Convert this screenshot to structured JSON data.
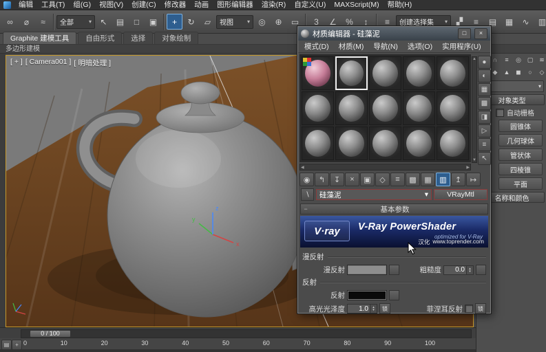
{
  "colors": {
    "accent_blue": "#2e5e8f",
    "viewport_border": "#c79a2c",
    "banner_blue": "#1a2a66",
    "wood_brown": "#6b4526",
    "selection_white": "#f0f0f0"
  },
  "ui": {
    "dropdown_arrow": "▾",
    "spin_up": "▴",
    "spin_down": "▾",
    "scroll_up": "▲",
    "scroll_down": "▼",
    "scroll_left": "◀",
    "scroll_right": "▶",
    "rollout_minus": "−",
    "eyedrop_glyph": "∖",
    "mini_track": "▤",
    "mini_plus": "+"
  },
  "menubar": {
    "items": [
      "编辑",
      "工具(T)",
      "组(G)",
      "视图(V)",
      "创建(C)",
      "修改器",
      "动画",
      "图形编辑器",
      "渲染(R)",
      "自定义(U)",
      "MAXScript(M)",
      "帮助(H)"
    ]
  },
  "toolbar": {
    "selection_filter": "全部",
    "ref_coord": "视图",
    "named_sets": "创建选择集",
    "icons_left": [
      {
        "glyph": "∞"
      },
      {
        "glyph": "⌀"
      },
      {
        "glyph": "≈"
      }
    ],
    "icons_select": [
      {
        "glyph": "↖"
      },
      {
        "glyph": "▤"
      },
      {
        "glyph": "□"
      },
      {
        "glyph": "▣"
      }
    ],
    "icons_transform": [
      {
        "glyph": "+"
      },
      {
        "glyph": "↻"
      },
      {
        "glyph": "▱"
      }
    ],
    "icons_mid": [
      {
        "glyph": "◎"
      },
      {
        "glyph": "⊕"
      },
      {
        "glyph": "▭"
      },
      {
        "glyph": "3"
      },
      {
        "glyph": "∠"
      },
      {
        "glyph": "%"
      },
      {
        "glyph": "↕"
      },
      {
        "glyph": "≡"
      }
    ],
    "icons_right": [
      {
        "glyph": "▞"
      },
      {
        "glyph": "≡"
      },
      {
        "glyph": "▤"
      },
      {
        "glyph": "▦"
      },
      {
        "glyph": "∿"
      },
      {
        "glyph": "▥"
      },
      {
        "glyph": "▣"
      },
      {
        "glyph": "□"
      },
      {
        "glyph": "◉"
      }
    ]
  },
  "ribbon": {
    "tabs": [
      {
        "label": "Graphite 建模工具"
      },
      {
        "label": "自由形式"
      },
      {
        "label": "选择"
      },
      {
        "label": "对象绘制"
      }
    ],
    "sub": "多边形建模"
  },
  "viewport": {
    "label_plus": "[ + ]",
    "label_camera": "[ Camera001 ]",
    "label_shading": "[ 明暗处理 ]",
    "axis": {
      "x": "x",
      "y": "y",
      "z": "z"
    }
  },
  "command_panel": {
    "tab_icons": [
      {
        "glyph": "+"
      },
      {
        "glyph": "∩"
      },
      {
        "glyph": "≡"
      },
      {
        "glyph": "◎"
      },
      {
        "glyph": "▢"
      },
      {
        "glyph": "≋"
      }
    ],
    "sub_icons": [
      {
        "glyph": "●"
      },
      {
        "glyph": "◆"
      },
      {
        "glyph": "▲"
      },
      {
        "glyph": "◼"
      },
      {
        "glyph": "○"
      },
      {
        "glyph": "◇"
      },
      {
        "glyph": "⌂"
      }
    ],
    "object_type": "对象类型",
    "autogrid": "自动栅格",
    "buttons": [
      {
        "label": "圆锥体"
      },
      {
        "label": "几何球体"
      },
      {
        "label": "管状体"
      },
      {
        "label": "四棱锥"
      },
      {
        "label": "平面"
      }
    ],
    "name_color": "名称和颜色"
  },
  "material_editor": {
    "title": "材质编辑器 - 硅藻泥",
    "window_buttons": {
      "restore": "□",
      "close": "×"
    },
    "menu": [
      {
        "label": "模式(D)"
      },
      {
        "label": "材质(M)"
      },
      {
        "label": "导航(N)"
      },
      {
        "label": "选项(O)"
      },
      {
        "label": "实用程序(U)"
      }
    ],
    "side_icons": [
      {
        "glyph": "●"
      },
      {
        "glyph": "◐"
      },
      {
        "glyph": "▦"
      },
      {
        "glyph": "▩"
      },
      {
        "glyph": "◨"
      },
      {
        "glyph": "▷"
      },
      {
        "glyph": "≡"
      },
      {
        "glyph": "↖"
      }
    ],
    "tool_icons": [
      {
        "glyph": "◉"
      },
      {
        "glyph": "↰"
      },
      {
        "glyph": "↧"
      },
      {
        "glyph": "×"
      },
      {
        "glyph": "▣"
      },
      {
        "glyph": "◇"
      },
      {
        "glyph": "≡"
      },
      {
        "glyph": "▩"
      },
      {
        "glyph": "▦"
      },
      {
        "glyph": "▥"
      },
      {
        "glyph": "↥"
      },
      {
        "glyph": "↦"
      }
    ],
    "material_name": "硅藻泥",
    "material_type": "VRayMtl",
    "rollout_basic": "基本参数",
    "banner": {
      "logo": "V·ray",
      "title": "V-Ray PowerShader",
      "optimized": "optimized for V-Ray",
      "loc": "汉化",
      "site": "www.toprender.com"
    },
    "params": {
      "diffuse_group": "漫反射",
      "diffuse_label": "漫反射",
      "roughness_label": "粗糙度",
      "roughness_value": "0.0",
      "reflection_group": "反射",
      "reflection_label": "反射",
      "hilight_label": "高光光泽度",
      "hilight_value": "1.0",
      "lock": "锁",
      "fresnel_label": "菲涅耳反射"
    }
  },
  "timeline": {
    "frame_display": "0 / 100",
    "ticks": [
      "0",
      "10",
      "20",
      "30",
      "40",
      "50",
      "60",
      "70",
      "80",
      "90",
      "100"
    ]
  }
}
